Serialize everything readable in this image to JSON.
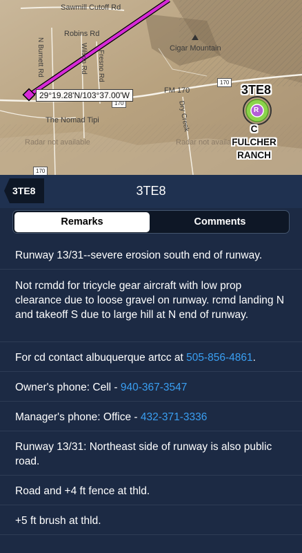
{
  "map": {
    "road_labels": [
      "Sawmill Cutoff Rd",
      "Robins Rd",
      "N Burnett Rd",
      "Wilson Rd",
      "Fresno Rd",
      "Cigar Mountain",
      "FM 170",
      "The Nomad Tipi",
      "Radar not available",
      "Radar not available",
      "Dry Creek"
    ],
    "route_badges": [
      "170",
      "170",
      "170"
    ],
    "coordinate": "29°19.28'N/103°37.00'W",
    "airport_id": "3TE8",
    "airport_marker": "R",
    "airport_name": "C FULCHER RANCH"
  },
  "header": {
    "back_label": "3TE8",
    "title": "3TE8"
  },
  "segments": {
    "remarks": "Remarks",
    "comments": "Comments",
    "selected": "Remarks"
  },
  "remarks": [
    {
      "text": "Runway 13/31--severe erosion south end of runway."
    },
    {
      "text": "Not rcmdd for tricycle gear aircraft with low prop clearance due to loose gravel on runway. rcmd landing N and takeoff S due to large hill at N end of runway."
    },
    {
      "prefix": "For cd contact albuquerque artcc at ",
      "link": "505-856-4861",
      "suffix": "."
    },
    {
      "prefix": "Owner's phone: Cell - ",
      "link": "940-367-3547",
      "suffix": ""
    },
    {
      "prefix": "Manager's phone: Office - ",
      "link": "432-371-3336",
      "suffix": ""
    },
    {
      "text": "Runway 13/31: Northeast side of runway is also public road."
    },
    {
      "text": "Road and +4 ft fence at thld."
    },
    {
      "text": "+5 ft brush at thld."
    }
  ],
  "colors": {
    "route": "#d62ad6",
    "link": "#3a9ff2",
    "background": "#1c2a44",
    "airport_marker": "#b45fd6"
  }
}
